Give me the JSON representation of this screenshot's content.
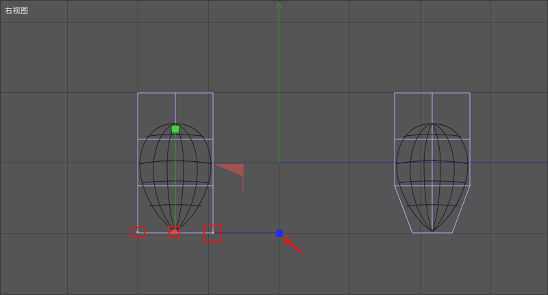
{
  "viewport": {
    "label": "右视图",
    "background": "#555555",
    "grid_color": "#3f3f3f"
  },
  "colors": {
    "lattice": "#b8a8ff",
    "mesh": "#1c1c1c",
    "y_axis": "#2fa02f",
    "x_axis": "#2626b0",
    "handle_green": "#33dd33",
    "handle_blue": "#2a2aff",
    "highlight_red": "#e01b1b",
    "gizmo_red": "#c05050",
    "arrow_red": "#e01b1b"
  },
  "icons": {
    "y_axis_arrow": "arrow-up-icon",
    "annotation_arrow": "arrow-pointer-icon"
  }
}
